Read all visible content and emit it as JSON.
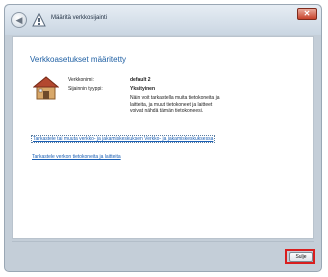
{
  "window": {
    "title": "Määritä verkkosijainti",
    "back_glyph": "◀",
    "close_glyph": "✕"
  },
  "main": {
    "heading": "Verkkoasetukset määritetty",
    "network_name_label": "Verkkonimi:",
    "network_name_value": "default 2",
    "location_type_label": "Sijainnin tyyppi:",
    "location_type_value": "Yksityinen",
    "description": "Näin voit tarkastella muita tietokoneita ja laitteita, ja muut tietokoneet ja laitteet voivat nähdä tämän tietokoneesi."
  },
  "links": {
    "link1": "Tarkastele tai muuta verkko- ja jakamiskeskuksen Verkko- ja jakamiskeskuksessa",
    "link2": "Tarkastele verkon tietokoneita ja laitteita"
  },
  "footer": {
    "close_label": "Sulje"
  },
  "colors": {
    "accent_link": "#1a5fb4",
    "highlight_box": "#d91e1e",
    "heading": "#1e5fa3"
  },
  "icons": {
    "back": "back-arrow-icon",
    "network": "network-icon",
    "house": "home-network-icon",
    "close": "close-icon"
  }
}
